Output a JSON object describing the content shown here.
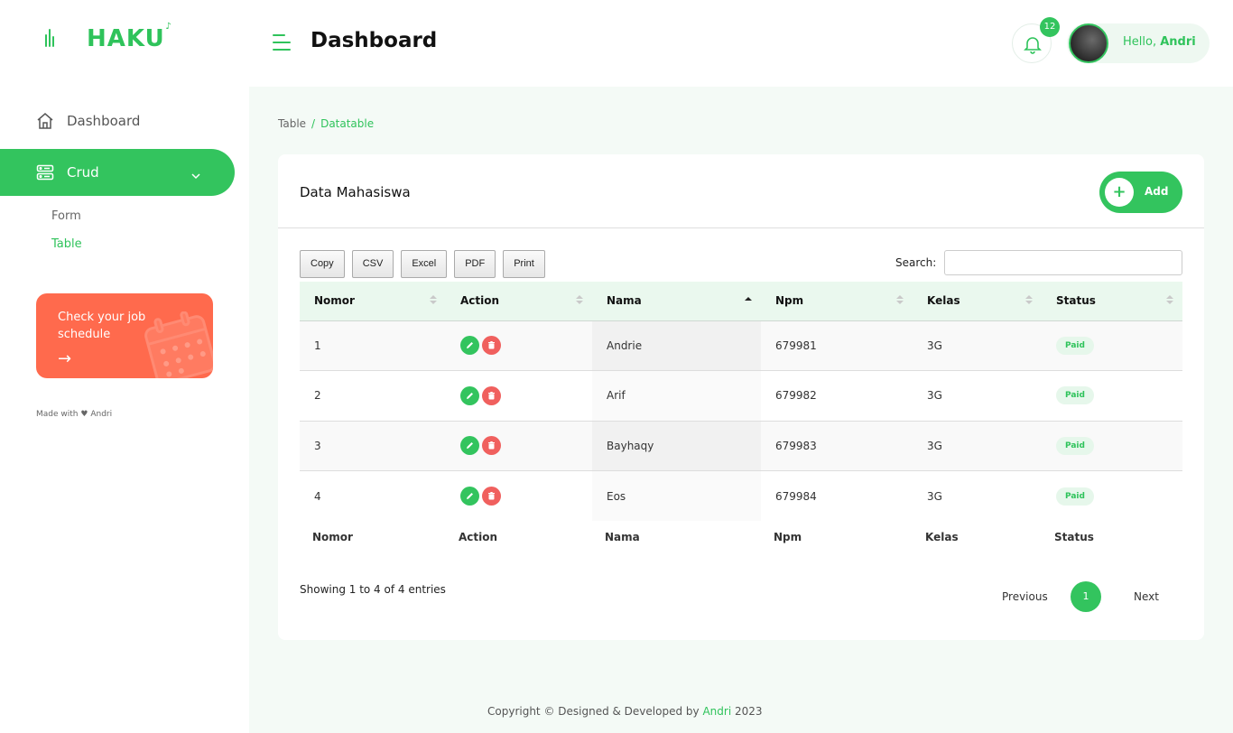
{
  "sidebar": {
    "logo_text": "HAKU",
    "nav": [
      {
        "label": "Dashboard",
        "icon": "home-icon"
      },
      {
        "label": "Crud",
        "icon": "server-icon"
      }
    ],
    "sub": [
      {
        "label": "Form"
      },
      {
        "label": "Table"
      }
    ],
    "promo": {
      "text": "Check your job schedule",
      "arrow": "→"
    },
    "made_with": {
      "prefix": "Made with",
      "suffix": "Andri"
    }
  },
  "header": {
    "title": "Dashboard",
    "notif_count": "12",
    "hello_prefix": "Hello,",
    "user_name": "Andri"
  },
  "breadcrumb": {
    "parent": "Table",
    "separator": "/",
    "current": "Datatable"
  },
  "card": {
    "title": "Data Mahasiswa",
    "add_label": "Add",
    "add_symbol": "+",
    "export_buttons": [
      "Copy",
      "CSV",
      "Excel",
      "PDF",
      "Print"
    ],
    "search_label": "Search:",
    "search_value": "",
    "columns": [
      "Nomor",
      "Action",
      "Nama",
      "Npm",
      "Kelas",
      "Status"
    ],
    "rows": [
      {
        "nomor": "1",
        "nama": "Andrie",
        "npm": "679981",
        "kelas": "3G",
        "status": "Paid"
      },
      {
        "nomor": "2",
        "nama": "Arif",
        "npm": "679982",
        "kelas": "3G",
        "status": "Paid"
      },
      {
        "nomor": "3",
        "nama": "Bayhaqy",
        "npm": "679983",
        "kelas": "3G",
        "status": "Paid"
      },
      {
        "nomor": "4",
        "nama": "Eos",
        "npm": "679984",
        "kelas": "3G",
        "status": "Paid"
      }
    ],
    "info": "Showing 1 to 4 of 4 entries",
    "pagination": {
      "previous": "Previous",
      "current": "1",
      "next": "Next"
    }
  },
  "footer": {
    "prefix": "Copyright © Designed & Developed by",
    "brand": "Andri",
    "year": "2023"
  },
  "colors": {
    "accent": "#33c45e",
    "promo": "#ff6a4d",
    "danger": "#f0605e"
  }
}
